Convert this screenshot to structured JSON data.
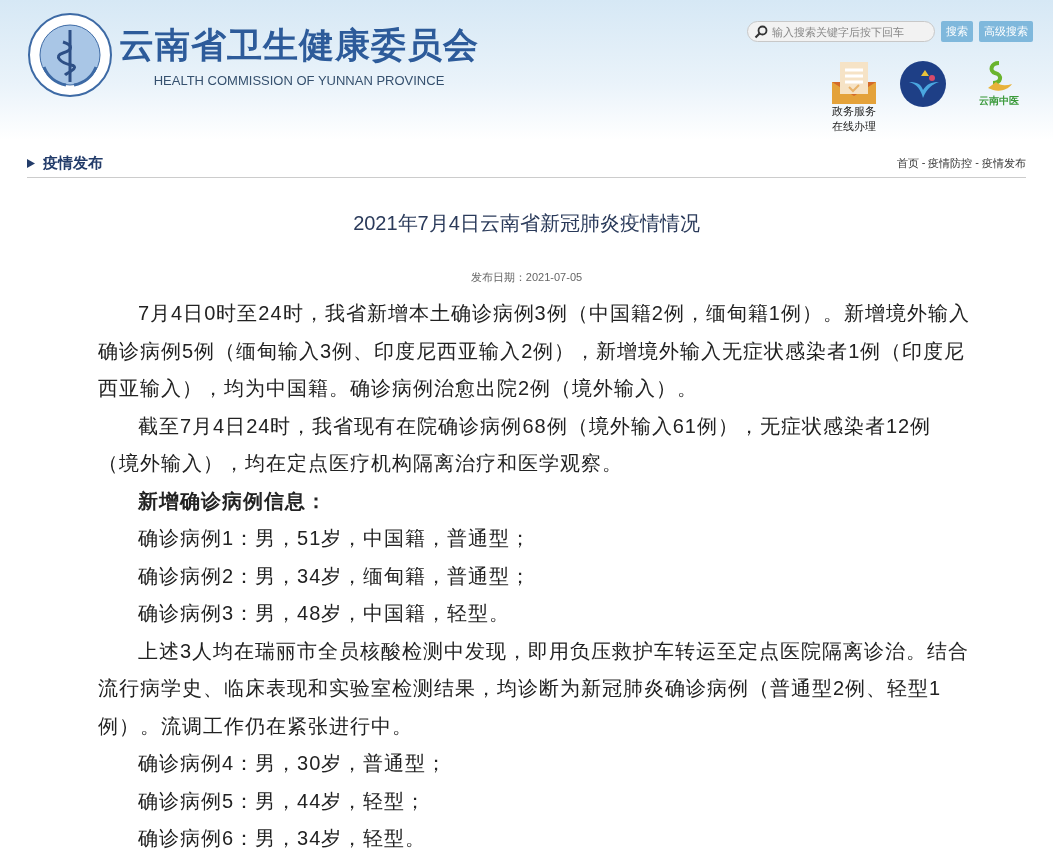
{
  "header": {
    "title": "云南省卫生健康委员会",
    "subtitle": "HEALTH COMMISSION OF YUNNAN PROVINCE",
    "search": {
      "placeholder": "输入搜索关键字后按下回车"
    },
    "buttons": [
      "搜索",
      "高级搜索"
    ],
    "service": {
      "lines": [
        "政务服务",
        "在线办理"
      ]
    },
    "tcm_logo_text": "云南中医"
  },
  "section": {
    "title": "疫情发布",
    "breadcrumb": [
      "首页",
      "-",
      "疫情防控",
      "-",
      "疫情发布"
    ]
  },
  "article": {
    "title": "2021年7月4日云南省新冠肺炎疫情情况",
    "date": "发布日期：2021-07-05",
    "blocks": [
      {
        "kind": "para",
        "text": "7月4日0时至24时，我省新增本土确诊病例3例（中国籍2例，缅甸籍1例）。新增境外输入确诊病例5例（缅甸输入3例、印度尼西亚输入2例），新增境外输入无症状感染者1例（印度尼西亚输入），均为中国籍。确诊病例治愈出院2例（境外输入）。"
      },
      {
        "kind": "para",
        "text": "截至7月4日24时，我省现有在院确诊病例68例（境外输入61例），无症状感染者12例（境外输入），均在定点医疗机构隔离治疗和医学观察。"
      },
      {
        "kind": "heading",
        "text": "新增确诊病例信息："
      },
      {
        "kind": "para",
        "text": "确诊病例1：男，51岁，中国籍，普通型；"
      },
      {
        "kind": "para",
        "text": "确诊病例2：男，34岁，缅甸籍，普通型；"
      },
      {
        "kind": "para",
        "text": "确诊病例3：男，48岁，中国籍，轻型。"
      },
      {
        "kind": "para",
        "text": "上述3人均在瑞丽市全员核酸检测中发现，即用负压救护车转运至定点医院隔离诊治。结合流行病学史、临床表现和实验室检测结果，均诊断为新冠肺炎确诊病例（普通型2例、轻型1例）。流调工作仍在紧张进行中。"
      },
      {
        "kind": "para",
        "text": "确诊病例4：男，30岁，普通型；"
      },
      {
        "kind": "para",
        "text": "确诊病例5：男，44岁，轻型；"
      },
      {
        "kind": "para",
        "text": "确诊病例6：男，34岁，轻型。"
      }
    ]
  }
}
